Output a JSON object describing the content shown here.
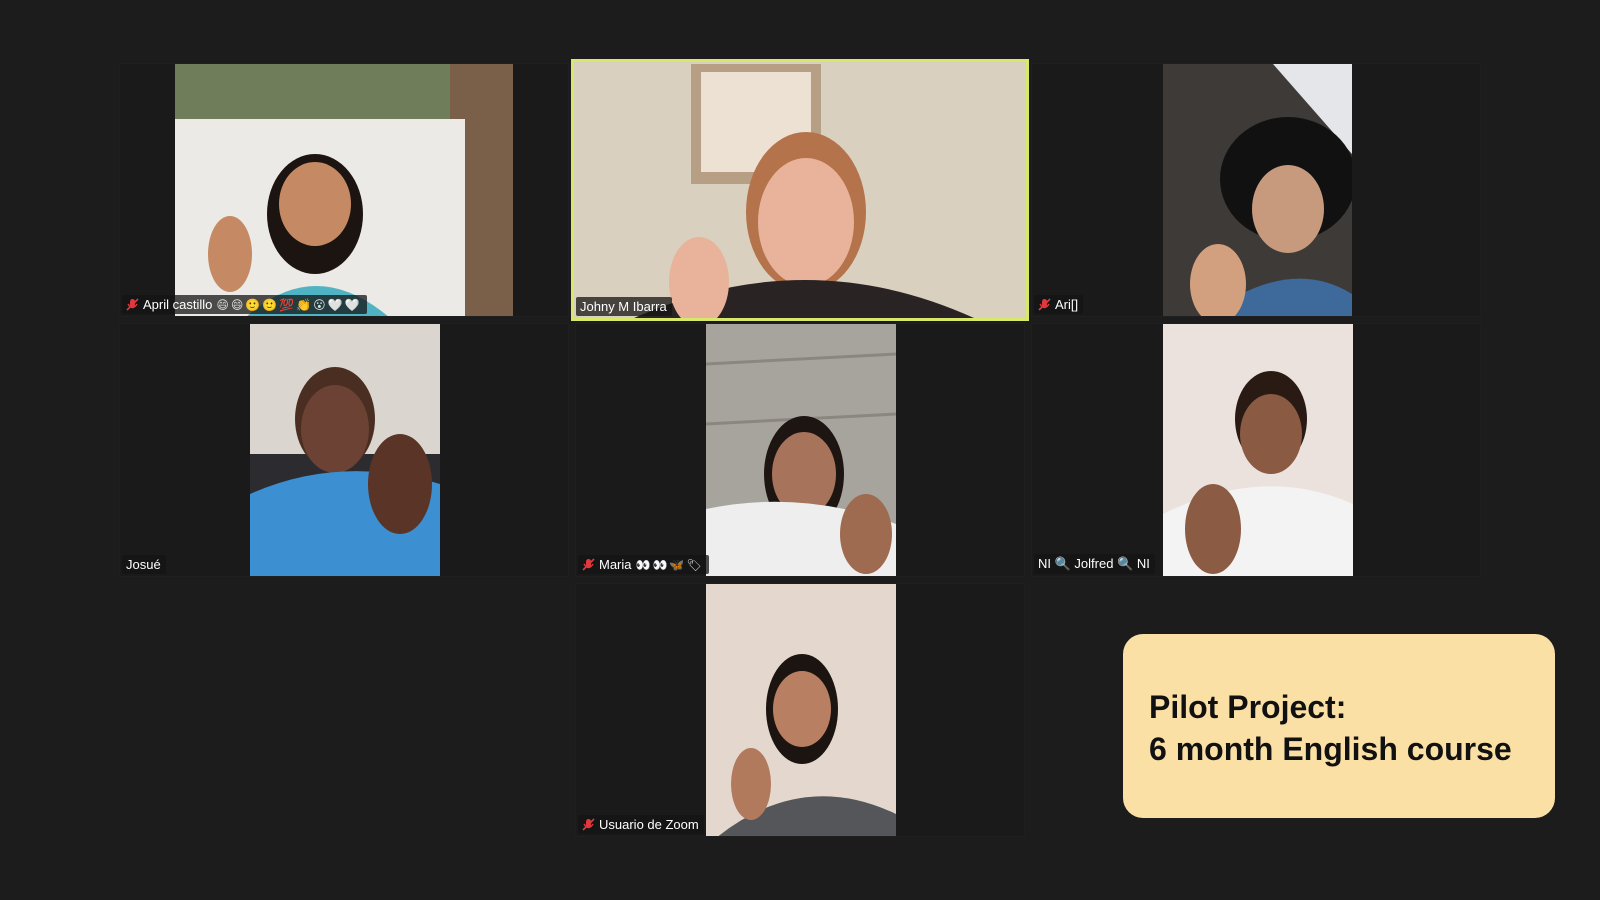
{
  "meeting": {
    "participants": [
      {
        "id": "p1",
        "name": "April castillo",
        "suffix": "😄😄🙂🙂💯👏😮🤍🤍",
        "muted": true,
        "active": false
      },
      {
        "id": "p2",
        "name": "Johny M Ibarra",
        "suffix": "",
        "muted": false,
        "active": true
      },
      {
        "id": "p3",
        "name": "Ari[]",
        "suffix": "",
        "muted": true,
        "active": false
      },
      {
        "id": "p4",
        "name": "Josué",
        "suffix": "",
        "muted": false,
        "active": false
      },
      {
        "id": "p5",
        "name": "Maria",
        "suffix": "👀👀🦋🏷",
        "muted": true,
        "active": false
      },
      {
        "id": "p6",
        "name": "NI 🔍 Jolfred 🔍 NI",
        "suffix": "",
        "muted": false,
        "active": false
      },
      {
        "id": "p7",
        "name": "Usuario de Zoom",
        "suffix": "",
        "muted": true,
        "active": false
      }
    ]
  },
  "caption": {
    "line1": "Pilot Project:",
    "line2": "6 month English course"
  },
  "colors": {
    "background": "#1c1c1c",
    "active_speaker_border": "#d7e86a",
    "caption_bg": "#fbe0a6",
    "muted_icon": "#e0393e"
  },
  "icons": {
    "muted": "microphone-muted-icon"
  }
}
